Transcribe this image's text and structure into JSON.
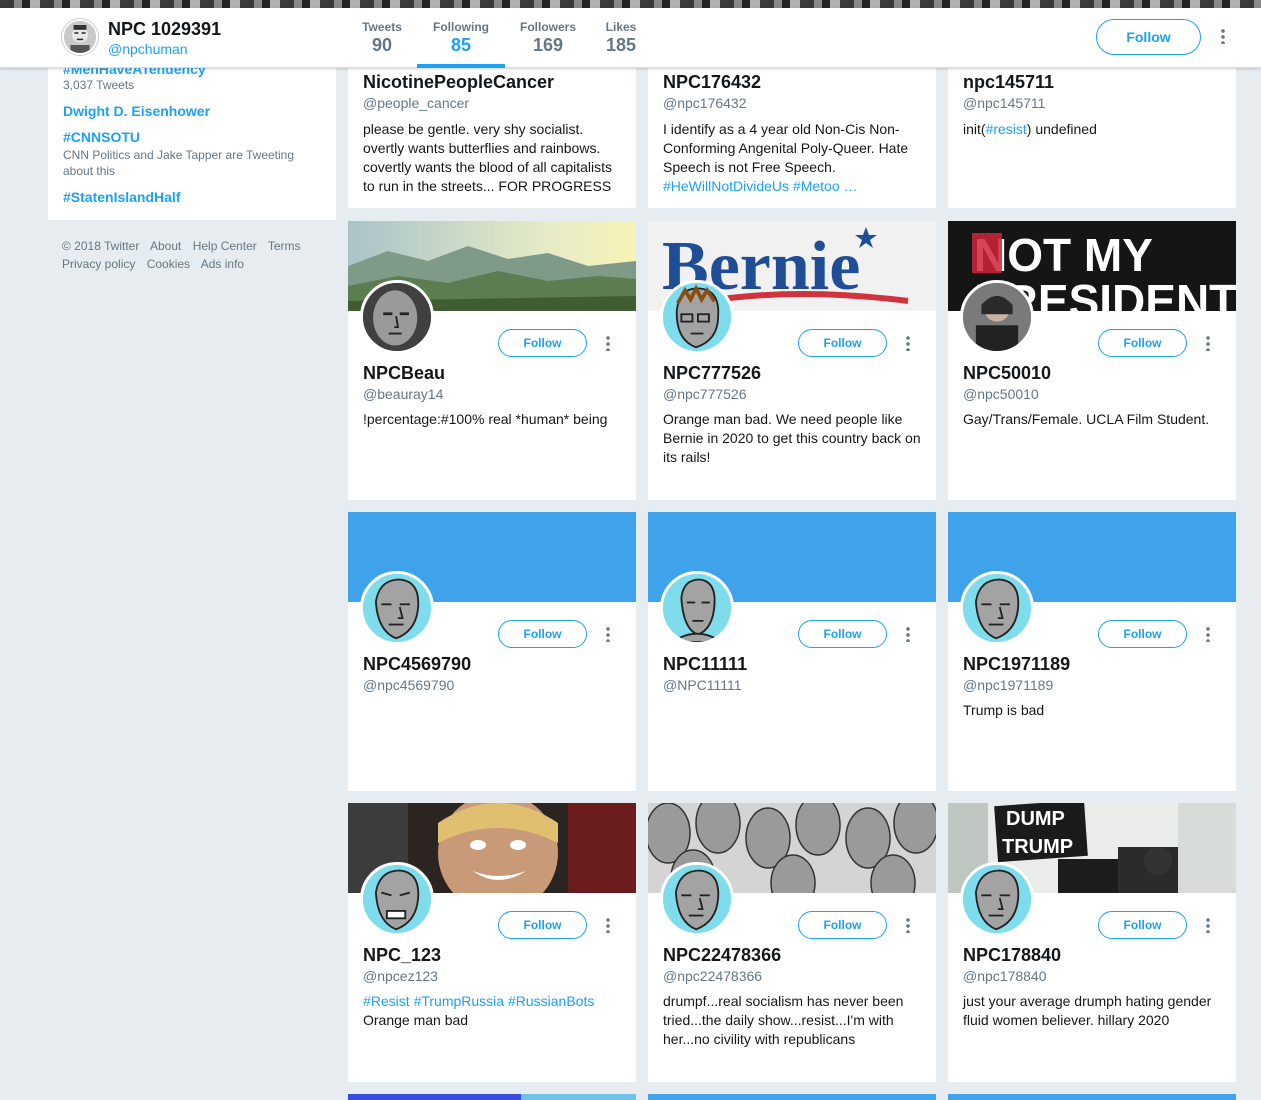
{
  "profile": {
    "name": "NPC 1029391",
    "handle": "@npchuman",
    "stats": [
      {
        "label": "Tweets",
        "value": "90"
      },
      {
        "label": "Following",
        "value": "85"
      },
      {
        "label": "Followers",
        "value": "169"
      },
      {
        "label": "Likes",
        "value": "185"
      }
    ],
    "follow_label": "Follow"
  },
  "trends": [
    {
      "name": "#MenHaveATendency",
      "sub": "3,037 Tweets"
    },
    {
      "name": "Dwight D. Eisenhower",
      "sub": ""
    },
    {
      "name": "#CNNSOTU",
      "sub": "CNN Politics and Jake Tapper are Tweeting about this"
    },
    {
      "name": "#StatenIslandHalf",
      "sub": ""
    }
  ],
  "footer": {
    "links": [
      "© 2018 Twitter",
      "About",
      "Help Center",
      "Terms",
      "Privacy policy",
      "Cookies",
      "Ads info"
    ]
  },
  "cards": [
    {
      "name": "NicotinePeopleCancer",
      "handle": "@people_cancer",
      "bio": "please be gentle. very shy socialist. overtly wants butterflies and rainbows. covertly wants the blood of all capitalists to run in the streets... FOR PROGRESS"
    },
    {
      "name": "NPC176432",
      "handle": "@npc176432",
      "bio": "I identify as a 4 year old Non-Cis Non-Conforming Angenital Poly-Queer. Hate Speech is not Free Speech.",
      "bio_tags": "#HeWillNotDivideUs #Metoo …"
    },
    {
      "name": "npc145711",
      "handle": "@npc145711",
      "bio_pre": "init(",
      "bio_tag": "#resist",
      "bio_post": ") undefined"
    },
    {
      "name": "NPCBeau",
      "handle": "@beauray14",
      "bio": "!percentage:#100% real *human* being"
    },
    {
      "name": "NPC777526",
      "handle": "@npc777526",
      "bio": "Orange man bad. We need people like Bernie in 2020 to get this country back on its rails!",
      "banner_text": "Bernie"
    },
    {
      "name": "NPC50010",
      "handle": "@npc50010",
      "bio": "Gay/Trans/Female. UCLA Film Student.",
      "banner_text_1": "NOT MY",
      "banner_text_2": "PRESIDENT"
    },
    {
      "name": "NPC4569790",
      "handle": "@npc4569790",
      "bio": ""
    },
    {
      "name": "NPC11111",
      "handle": "@NPC11111",
      "bio": ""
    },
    {
      "name": "NPC1971189",
      "handle": "@npc1971189",
      "bio": "Trump is bad"
    },
    {
      "name": "NPC_123",
      "handle": "@npcez123",
      "bio_tags": "#Resist #TrumpRussia #RussianBots",
      "bio": "Orange man bad"
    },
    {
      "name": "NPC22478366",
      "handle": "@npc22478366",
      "bio": "drumpf...real socialism has never been tried...the daily show...resist...I'm with her...no civility with republicans"
    },
    {
      "name": "NPC178840",
      "handle": "@npc178840",
      "bio": "just your average drumph hating gender fluid women believer. hillary 2020",
      "banner_text_1": "DUMP",
      "banner_text_2": "TRUMP"
    }
  ],
  "colors": {
    "accent": "#1da1f2",
    "background": "#e6ecf0",
    "secondary_text": "#657786"
  }
}
